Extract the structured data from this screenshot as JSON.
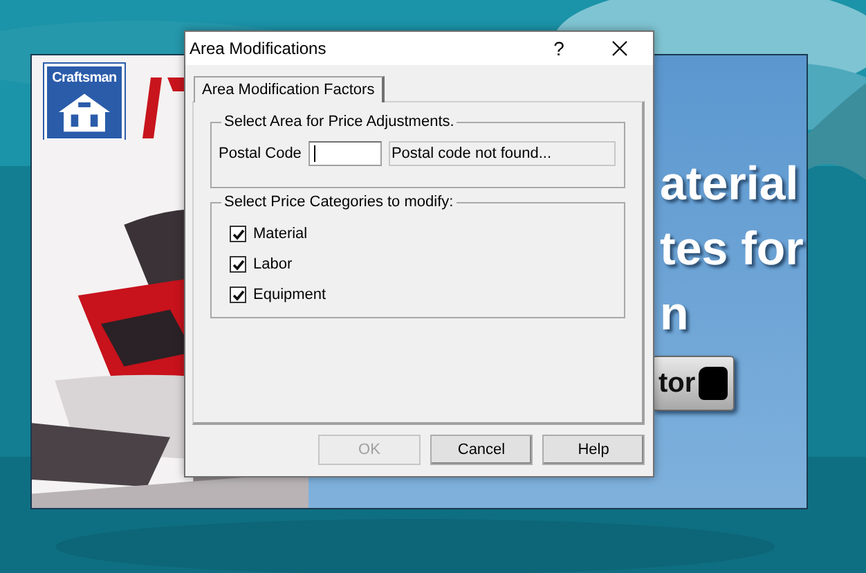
{
  "splash": {
    "logo_text": "Craftsman",
    "text_lines": [
      "aterial",
      "tes for",
      "n"
    ],
    "badge_text": "tor"
  },
  "dialog": {
    "title": "Area Modifications",
    "help_button": "?",
    "tabs": [
      {
        "label": "Area Modification Factors",
        "selected": true
      }
    ],
    "area_group": {
      "title": "Select Area for Price Adjustments.",
      "postal_label": "Postal Code",
      "status": "Postal code not found..."
    },
    "category_group": {
      "title": "Select Price Categories to modify:",
      "categories": [
        {
          "label": "Material",
          "checked": true
        },
        {
          "label": "Labor",
          "checked": true
        },
        {
          "label": "Equipment",
          "checked": true
        }
      ]
    },
    "buttons": [
      {
        "label": "OK",
        "disabled": true
      },
      {
        "label": "Cancel",
        "disabled": false
      },
      {
        "label": "Help",
        "disabled": false
      }
    ]
  }
}
